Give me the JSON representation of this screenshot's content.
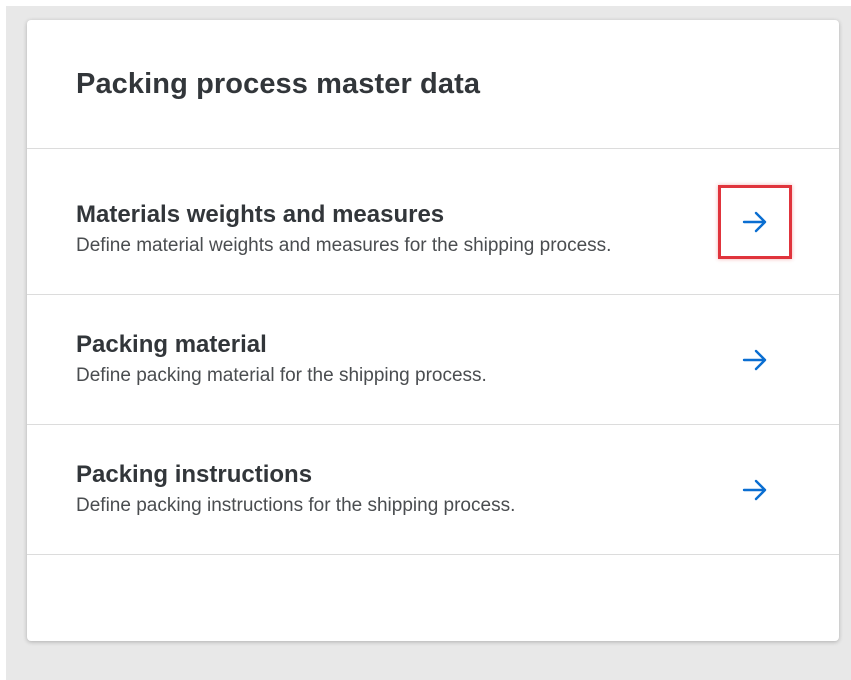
{
  "card": {
    "title": "Packing process master data",
    "items": [
      {
        "title": "Materials weights and measures",
        "description": "Define material weights and measures for the shipping process.",
        "icon": "arrow-right-icon",
        "highlighted": true
      },
      {
        "title": "Packing material",
        "description": "Define packing material for the shipping process.",
        "icon": "arrow-right-icon",
        "highlighted": false
      },
      {
        "title": "Packing instructions",
        "description": "Define packing instructions for the shipping process.",
        "icon": "arrow-right-icon",
        "highlighted": false
      }
    ]
  },
  "colors": {
    "accent": "#0a6ed1",
    "highlight_border": "#e0343c",
    "text_primary": "#32363a",
    "divider": "#dcdcdc",
    "backdrop": "#e8e8e8"
  }
}
